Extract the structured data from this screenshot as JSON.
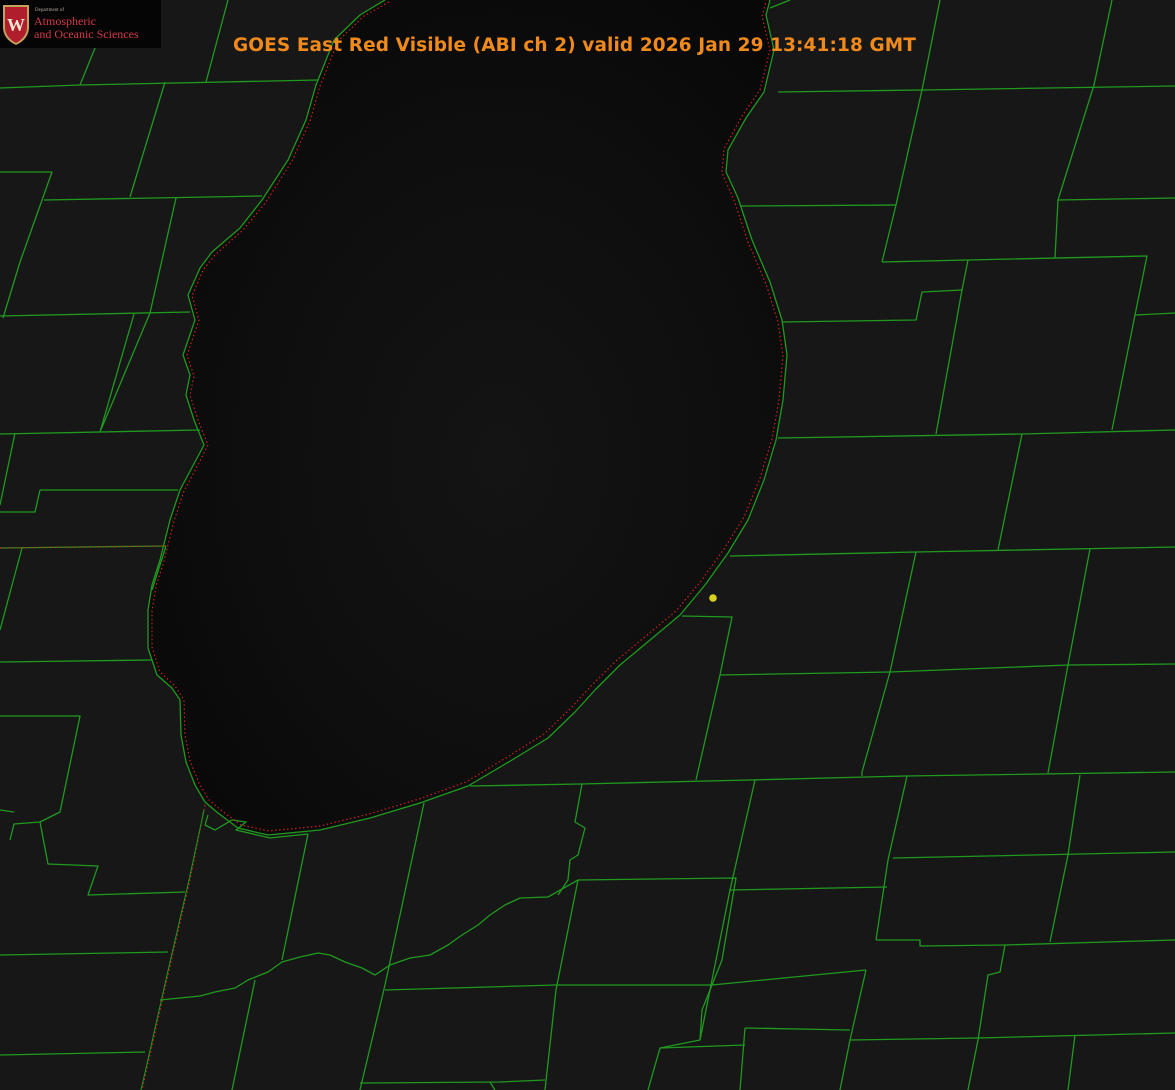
{
  "image": {
    "title": "GOES East Red Visible (ABI ch 2) valid 2026 Jan 29 13:41:18 GMT",
    "colors": {
      "background": "#161616",
      "lake": "#0b0b0b",
      "county_borders": "#1f9a1f",
      "state_borders": "#cc2222",
      "title_text": "#f08a1c",
      "marker": "#d9d21c"
    }
  },
  "logo": {
    "department": "Department of",
    "line1": "Atmospheric",
    "line2": "and Oceanic Sciences",
    "seal_letter": "W",
    "seal_icon": "crest-icon"
  },
  "map": {
    "water_body": "lake",
    "marker_icon": "location-dot-icon"
  }
}
